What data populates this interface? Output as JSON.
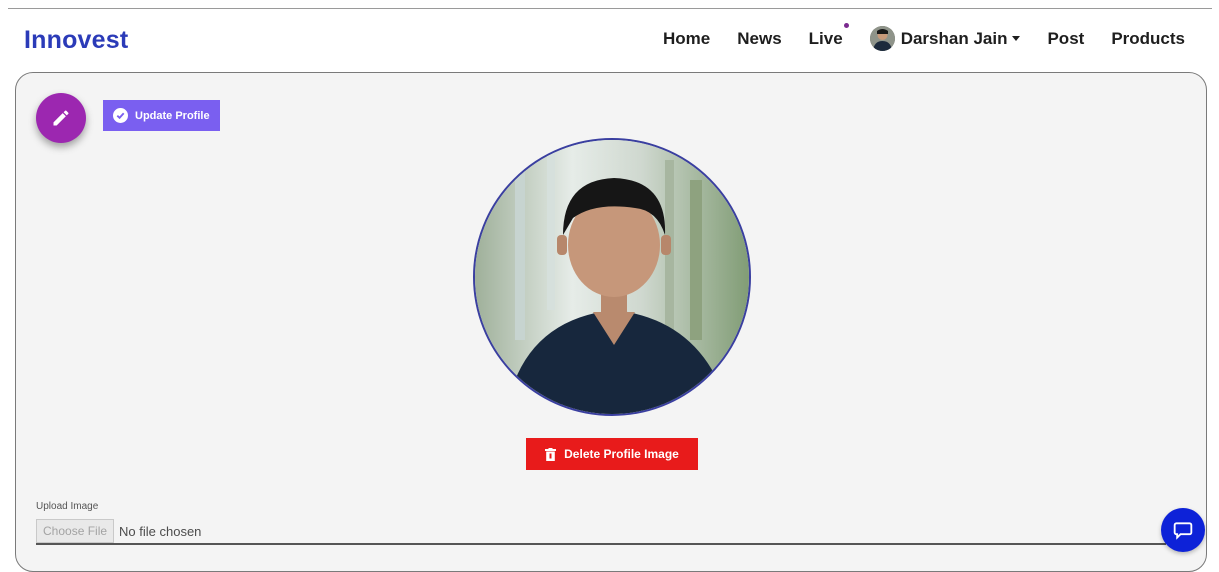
{
  "brand": "Innovest",
  "nav": {
    "home": "Home",
    "news": "News",
    "live": "Live",
    "user": "Darshan Jain",
    "post": "Post",
    "products": "Products"
  },
  "profile": {
    "update_label": "Update Profile",
    "delete_label": "Delete Profile Image",
    "upload_label": "Upload Image",
    "choose_file_label": "Choose File",
    "file_status": "No file chosen"
  },
  "icons": {
    "edit": "pencil-icon",
    "update": "check-circle-icon",
    "delete": "trash-icon",
    "dropdown": "caret-down-icon",
    "chat": "chat-icon",
    "notification": "dot-indicator"
  },
  "colors": {
    "brand": "#2b3bb8",
    "fab": "#9c27b0",
    "update_button": "#7a5ff0",
    "delete_button": "#e81b1b",
    "chat_button": "#0d22d8",
    "live_dot": "#7b2a8f"
  }
}
